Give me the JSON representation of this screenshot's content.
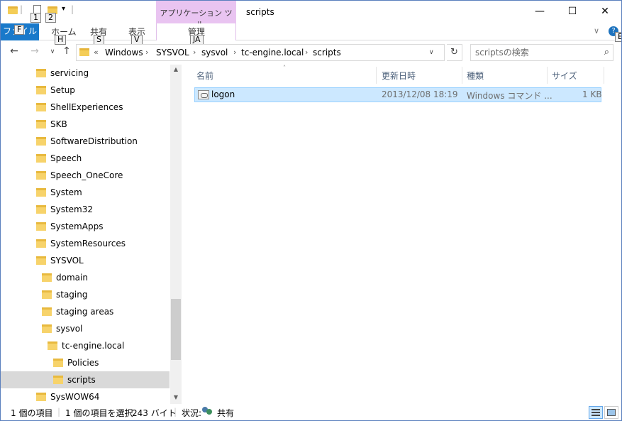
{
  "window": {
    "title": "scripts",
    "contextual_tab_group": "アプリケーション ツール"
  },
  "quick_access": {
    "keytip_1": "1",
    "keytip_2": "2"
  },
  "ribbon": {
    "file_label": "ファイル",
    "file_keytip": "F",
    "tabs": [
      {
        "label": "ホーム",
        "keytip": "H"
      },
      {
        "label": "共有",
        "keytip": "S"
      },
      {
        "label": "表示",
        "keytip": "V"
      },
      {
        "label": "管理",
        "keytip": "JA"
      }
    ],
    "help_keytip": "E"
  },
  "address": {
    "overflow": "«",
    "crumbs": [
      "Windows",
      "SYSVOL",
      "sysvol",
      "tc-engine.local",
      "scripts"
    ]
  },
  "search": {
    "placeholder": "scriptsの検索"
  },
  "nav_tree": [
    {
      "label": "servicing",
      "indent": 1
    },
    {
      "label": "Setup",
      "indent": 1
    },
    {
      "label": "ShellExperiences",
      "indent": 1
    },
    {
      "label": "SKB",
      "indent": 1
    },
    {
      "label": "SoftwareDistribution",
      "indent": 1
    },
    {
      "label": "Speech",
      "indent": 1
    },
    {
      "label": "Speech_OneCore",
      "indent": 1
    },
    {
      "label": "System",
      "indent": 1
    },
    {
      "label": "System32",
      "indent": 1
    },
    {
      "label": "SystemApps",
      "indent": 1
    },
    {
      "label": "SystemResources",
      "indent": 1
    },
    {
      "label": "SYSVOL",
      "indent": 1
    },
    {
      "label": "domain",
      "indent": 2
    },
    {
      "label": "staging",
      "indent": 2
    },
    {
      "label": "staging areas",
      "indent": 2
    },
    {
      "label": "sysvol",
      "indent": 2
    },
    {
      "label": "tc-engine.local",
      "indent": 3
    },
    {
      "label": "Policies",
      "indent": 4
    },
    {
      "label": "scripts",
      "indent": 4,
      "selected": true
    },
    {
      "label": "SysWOW64",
      "indent": 1
    }
  ],
  "columns": {
    "name": "名前",
    "date": "更新日時",
    "type": "種類",
    "size": "サイズ"
  },
  "files": [
    {
      "name": "logon",
      "date": "2013/12/08 18:19",
      "type": "Windows コマンド ...",
      "size": "1 KB"
    }
  ],
  "status": {
    "count": "1 個の項目",
    "selected": "1 個の項目を選択",
    "sel_size": "243 バイト",
    "state_label": "状況:",
    "state_value": "共有"
  }
}
